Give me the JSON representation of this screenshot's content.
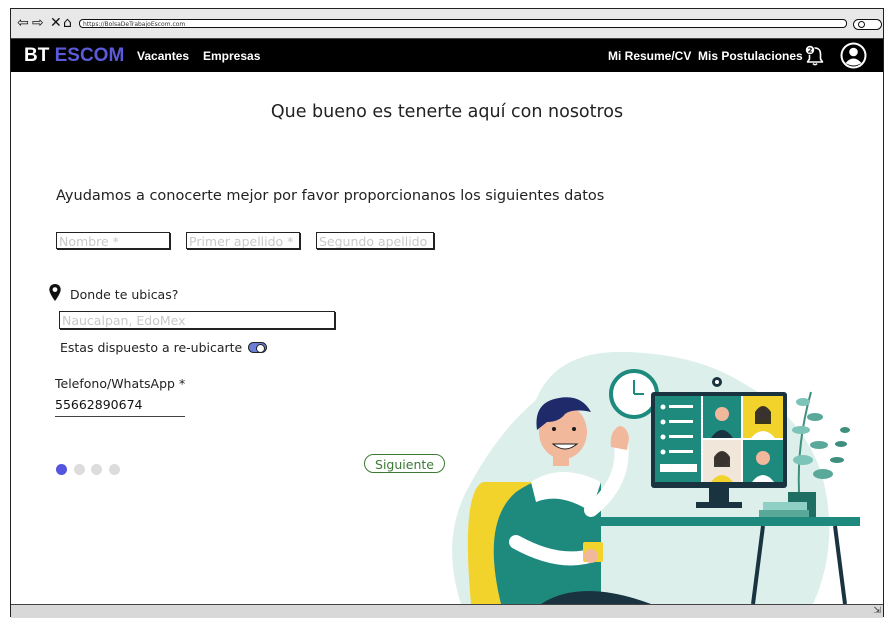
{
  "browser": {
    "url": "https://BolsaDeTrabajoEscom.com",
    "nav_icons": [
      "back-arrow-icon",
      "forward-arrow-icon",
      "close-icon",
      "home-icon"
    ],
    "search_icon": "search-icon"
  },
  "nav": {
    "logo_bt": "BT",
    "logo_escom": "ESCOM",
    "links": [
      "Vacantes",
      "Empresas"
    ],
    "right_links": [
      "Mi Resume/CV",
      "Mis Postulaciones"
    ],
    "notification_count": "2",
    "colors": {
      "bar": "#000000",
      "brand_accent": "#5b5bd9"
    }
  },
  "page": {
    "title": "Que bueno es tenerte aquí con nosotros",
    "subtitle": "Ayudamos a conocerte mejor por favor proporcionanos los siguientes datos"
  },
  "form": {
    "nombre_placeholder": "Nombre *",
    "primer_apellido_placeholder": "Primer apellido *",
    "segundo_apellido_placeholder": "Segundo apellido",
    "location_label": "Donde te ubicas?",
    "location_placeholder": "Naucalpan, EdoMex",
    "relocate_label": "Estas dispuesto a re-ubicarte",
    "relocate_on": true,
    "phone_label": "Telefono/WhatsApp  *",
    "phone_value": "55662890674",
    "next_button": "Siguiente"
  },
  "stepper": {
    "total": 4,
    "current": 1,
    "active_color": "#5454dc"
  }
}
